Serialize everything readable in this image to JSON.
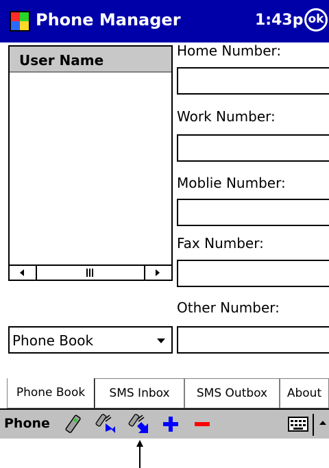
{
  "titlebar": {
    "app_name": "Phone Manager",
    "time": "1:43p",
    "ok_label": "ok"
  },
  "user_list": {
    "header": "User Name",
    "items": []
  },
  "fields": {
    "home": {
      "label": "Home Number:",
      "value": ""
    },
    "work": {
      "label": "Work Number:",
      "value": ""
    },
    "mobile": {
      "label": "Moblie Number:",
      "value": ""
    },
    "fax": {
      "label": "Fax Number:",
      "value": ""
    },
    "other": {
      "label": "Other Number:",
      "value": ""
    }
  },
  "source_dropdown": {
    "selected": "Phone Book"
  },
  "tabs": [
    {
      "label": "Phone Book",
      "active": true
    },
    {
      "label": "SMS Inbox",
      "active": false
    },
    {
      "label": "SMS Outbox",
      "active": false
    },
    {
      "label": "About",
      "active": false
    }
  ],
  "command_bar": {
    "menu_label": "Phone",
    "icons": [
      "phone-connect-icon",
      "phone-read-icon",
      "phone-write-icon",
      "add-icon",
      "remove-icon",
      "keyboard-icon",
      "sip-arrow-icon"
    ]
  },
  "colors": {
    "titlebar": "#0000a8",
    "toolbar_blue": "#0000ff",
    "toolbar_red": "#ff0000",
    "command_bar": "#c0c0c0"
  }
}
